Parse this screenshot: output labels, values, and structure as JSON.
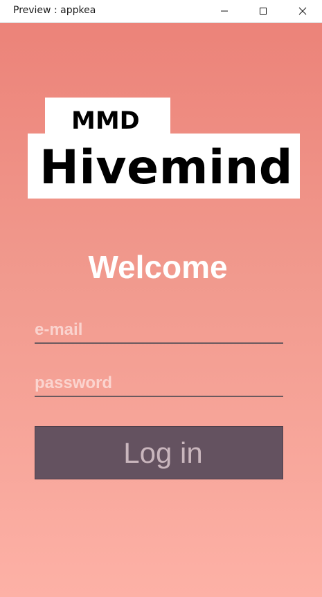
{
  "window": {
    "title": "Preview : appkea",
    "controls": {
      "minimize_icon": "minimize-icon",
      "maximize_icon": "maximize-icon",
      "close_icon": "close-icon"
    }
  },
  "logo": {
    "top_text": "MMD",
    "main_text": "Hivemind"
  },
  "welcome": "Welcome",
  "form": {
    "email_placeholder": "e-mail",
    "email_value": "",
    "password_placeholder": "password",
    "password_value": "",
    "login_label": "Log in"
  },
  "colors": {
    "background_top": "#ec8379",
    "background_bottom": "#fdb1a6",
    "button": "#645260",
    "button_text": "#c9b6bd",
    "underline": "#6b5a5e"
  }
}
